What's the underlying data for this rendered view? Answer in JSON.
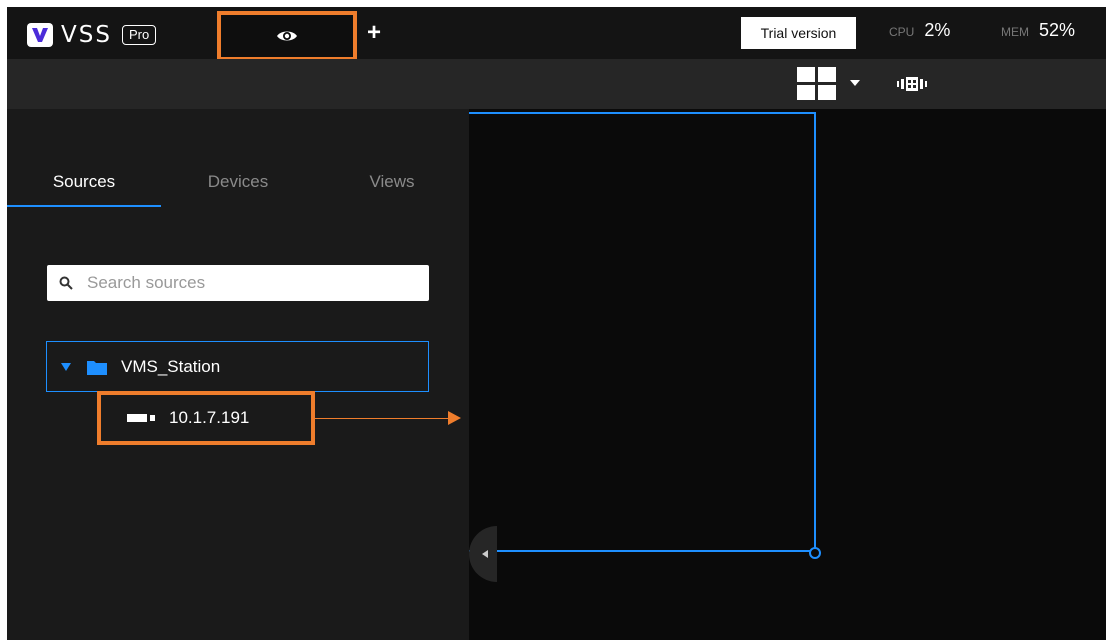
{
  "app": {
    "logo_text": "VSS",
    "badge": "Pro"
  },
  "topbar": {
    "view_tab_icon": "eye-icon",
    "add_label": "+",
    "trial_label": "Trial version",
    "cpu_label": "CPU",
    "cpu_value": "2%",
    "mem_label": "MEM",
    "mem_value": "52%"
  },
  "toolbar": {
    "layout_icon": "grid-layout-icon",
    "layout_dropdown_icon": "caret-down-icon",
    "sequence_icon": "film-strip-icon"
  },
  "sidebar": {
    "tabs": [
      {
        "label": "Sources",
        "active": true
      },
      {
        "label": "Devices",
        "active": false
      },
      {
        "label": "Views",
        "active": false
      }
    ],
    "search": {
      "placeholder": "Search sources",
      "value": ""
    },
    "tree": {
      "group": "VMS_Station",
      "items": [
        {
          "label": "10.1.7.191",
          "icon": "camera-icon"
        }
      ]
    }
  },
  "colors": {
    "accent": "#1e8fff",
    "highlight": "#ef7d2c",
    "topbar_bg": "#141414",
    "sidebar_bg": "#1a1a1a",
    "video_bg": "#0a0a0a"
  }
}
